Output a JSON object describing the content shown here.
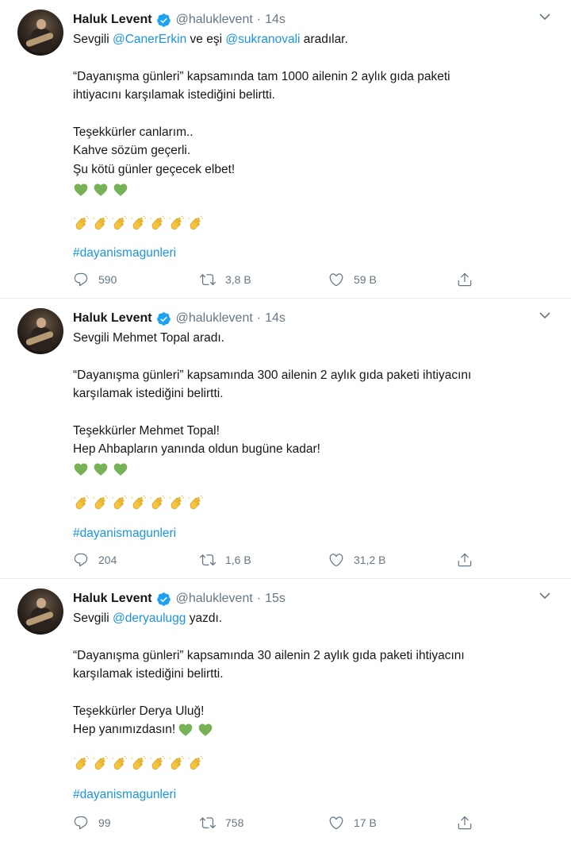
{
  "colors": {
    "accent": "#1b95e0",
    "muted": "#657786",
    "heart": "#77b255",
    "clap": "#f5c542"
  },
  "tweets": [
    {
      "author": {
        "name": "Haluk Levent",
        "handle": "@haluklevent",
        "time": "14s",
        "verified_icon": "verified-badge-icon"
      },
      "text": {
        "l1_pre": "Sevgili ",
        "l1_m1": "@CanerErkin",
        "l1_mid": " ve eşi ",
        "l1_m2": "@sukranovali",
        "l1_post": " aradılar.",
        "p2_l1": "“Dayanışma günleri” kapsamında tam 1000 ailenin 2 aylık gıda paketi",
        "p2_l2": "ihtiyacını karşılamak istediğini belirtti.",
        "p3_l1": "Teşekkürler canlarım..",
        "p3_l2": "Kahve sözüm geçerli.",
        "p3_l3": "Şu kötü günler geçecek elbet!",
        "hashtag": "#dayanismagunleri"
      },
      "emoji": {
        "hearts": 3,
        "claps": 7
      },
      "stats": {
        "replies": "590",
        "retweets": "3,8 B",
        "likes": "59 B"
      }
    },
    {
      "author": {
        "name": "Haluk Levent",
        "handle": "@haluklevent",
        "time": "14s",
        "verified_icon": "verified-badge-icon"
      },
      "text": {
        "l1": "Sevgili Mehmet Topal aradı.",
        "p2_l1": "“Dayanışma günleri” kapsamında 300 ailenin 2 aylık gıda paketi ihtiyacını",
        "p2_l2": "karşılamak istediğini belirtti.",
        "p3_l1": "Teşekkürler Mehmet Topal!",
        "p3_l2": "Hep Ahbapların yanında oldun bugüne kadar!",
        "hashtag": "#dayanismagunleri"
      },
      "emoji": {
        "hearts": 3,
        "claps": 7
      },
      "stats": {
        "replies": "204",
        "retweets": "1,6 B",
        "likes": "31,2 B"
      }
    },
    {
      "author": {
        "name": "Haluk Levent",
        "handle": "@haluklevent",
        "time": "15s",
        "verified_icon": "verified-badge-icon"
      },
      "text": {
        "l1_pre": "Sevgili ",
        "l1_m1": "@deryaulugg",
        "l1_post": " yazdı.",
        "p2_l1": "“Dayanışma günleri” kapsamında 30 ailenin 2 aylık gıda paketi ihtiyacını",
        "p2_l2": "karşılamak istediğini belirtti.",
        "p3_l1": "Teşekkürler Derya Uluğ!",
        "p3_l2": "Hep yanımızdasın!",
        "hashtag": "#dayanismagunleri"
      },
      "emoji": {
        "hearts": 2,
        "claps": 7
      },
      "stats": {
        "replies": "99",
        "retweets": "758",
        "likes": "17 B"
      }
    }
  ]
}
